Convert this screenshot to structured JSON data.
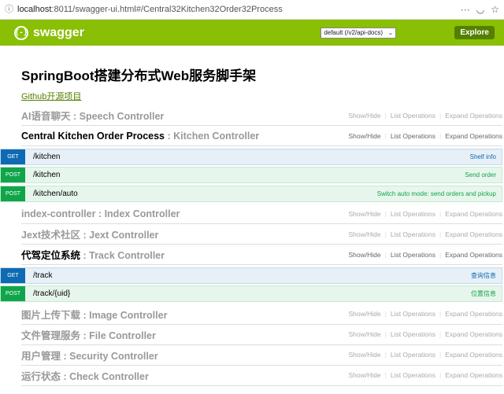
{
  "browser": {
    "url_host": "localhost",
    "url_rest": ":8011/swagger-ui.html#/Central32Kitchen32Order32Process"
  },
  "header": {
    "logo_symbol": "{-}",
    "logo_text": "swagger",
    "spec_selected": "default (/v2/api-docs)",
    "explore_label": "Explore"
  },
  "info": {
    "title": "SpringBoot搭建分布式Web服务脚手架",
    "link": "Github开源项目"
  },
  "resource_actions": {
    "show_hide": "Show/Hide",
    "list_operations": "List Operations",
    "expand_operations": "Expand Operations"
  },
  "resources": [
    {
      "name": "AI语音聊天",
      "controller": "Speech Controller"
    },
    {
      "name": "Central Kitchen Order Process",
      "controller": "Kitchen Controller"
    },
    {
      "name": "index-controller",
      "controller": "Index Controller"
    },
    {
      "name": "Jext技术社区",
      "controller": "Jext Controller"
    },
    {
      "name": "代驾定位系统",
      "controller": "Track Controller"
    },
    {
      "name": "图片上传下载",
      "controller": "Image Controller"
    },
    {
      "name": "文件管理服务",
      "controller": "File Controller"
    },
    {
      "name": "用户管理",
      "controller": "Security Controller"
    },
    {
      "name": "运行状态",
      "controller": "Check Controller"
    }
  ],
  "separator": " : ",
  "kitchen_operations": [
    {
      "method": "GET",
      "path": "/kitchen",
      "summary": "Shelf info"
    },
    {
      "method": "POST",
      "path": "/kitchen",
      "summary": "Send order"
    },
    {
      "method": "POST",
      "path": "/kitchen/auto",
      "summary": "Switch auto mode: send orders and pickup"
    }
  ],
  "track_operations": [
    {
      "method": "GET",
      "path": "/track",
      "summary": "查询信息"
    },
    {
      "method": "POST",
      "path": "/track/{uid}",
      "summary": "位置信息"
    }
  ],
  "colors": {
    "header_bg": "#89bf04",
    "explore_bg": "#547f00",
    "get": "#0f6ab4",
    "post": "#10a54a"
  }
}
